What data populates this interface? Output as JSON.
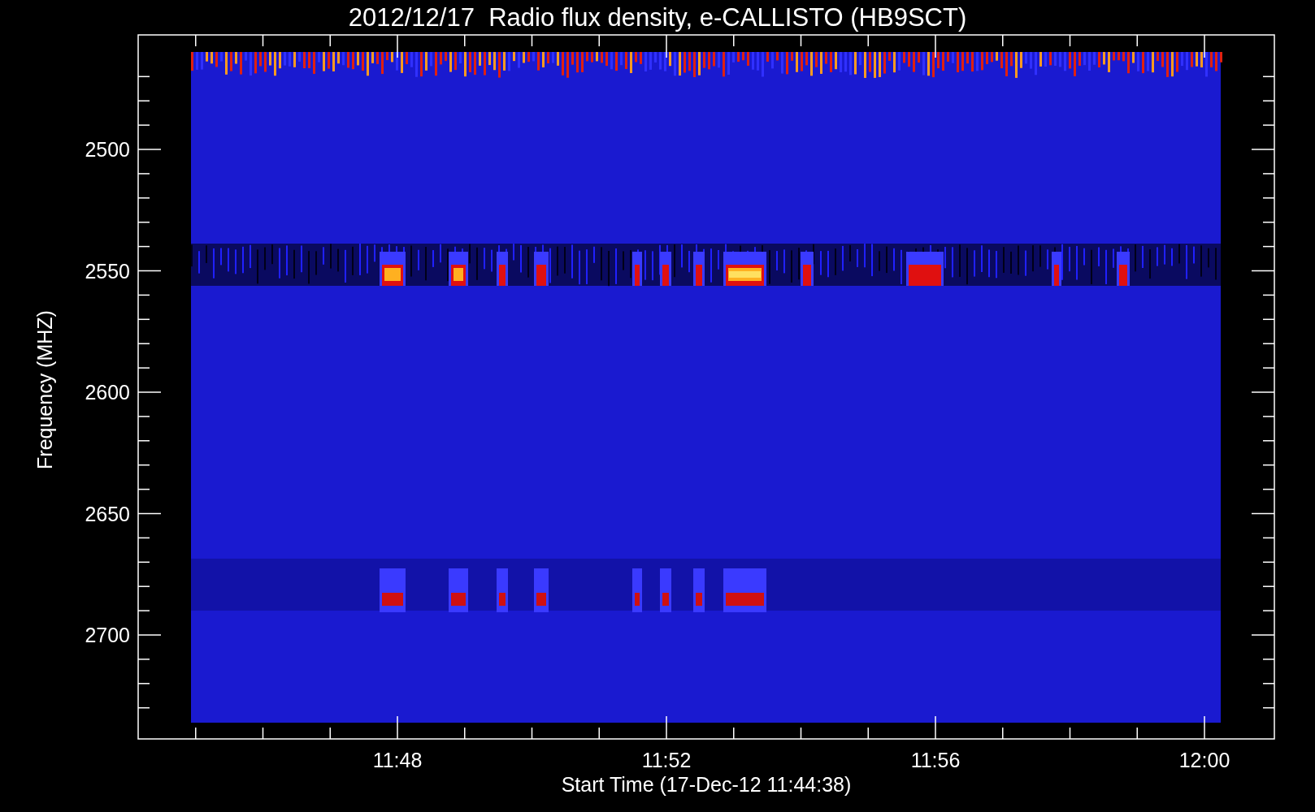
{
  "title": "2012/12/17  Radio flux density, e-CALLISTO (HB9SCT)",
  "y_axis": {
    "label": "Frequency (MHZ)",
    "ticks": [
      "2500",
      "2550",
      "2600",
      "2650",
      "2700"
    ]
  },
  "x_axis": {
    "label": "Start Time (17-Dec-12 11:44:38)",
    "ticks": [
      "11:48",
      "11:52",
      "11:56",
      "12:00"
    ]
  }
}
